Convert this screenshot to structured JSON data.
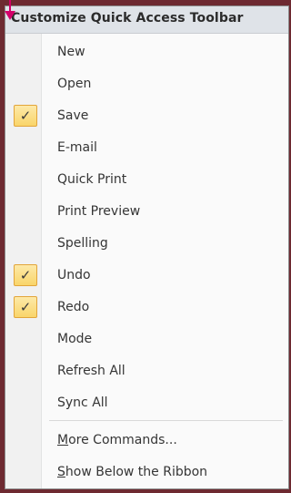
{
  "menu": {
    "title": "Customize Quick Access Toolbar",
    "items": [
      {
        "label": "New",
        "checked": false
      },
      {
        "label": "Open",
        "checked": false
      },
      {
        "label": "Save",
        "checked": true
      },
      {
        "label": "E-mail",
        "checked": false
      },
      {
        "label": "Quick Print",
        "checked": false
      },
      {
        "label": "Print Preview",
        "checked": false
      },
      {
        "label": "Spelling",
        "checked": false
      },
      {
        "label": "Undo",
        "checked": true
      },
      {
        "label": "Redo",
        "checked": true
      },
      {
        "label": "Mode",
        "checked": false
      },
      {
        "label": "Refresh All",
        "checked": false
      },
      {
        "label": "Sync All",
        "checked": false
      }
    ],
    "more_commands": {
      "mnemonic": "M",
      "rest": "ore Commands..."
    },
    "show_below": {
      "mnemonic": "S",
      "rest": "how Below the Ribbon"
    },
    "check_glyph": "✓"
  },
  "colors": {
    "background": "#6e2a31",
    "arrow": "#d4006a",
    "check_fill": "#f9d56a",
    "check_border": "#e2a53a"
  }
}
